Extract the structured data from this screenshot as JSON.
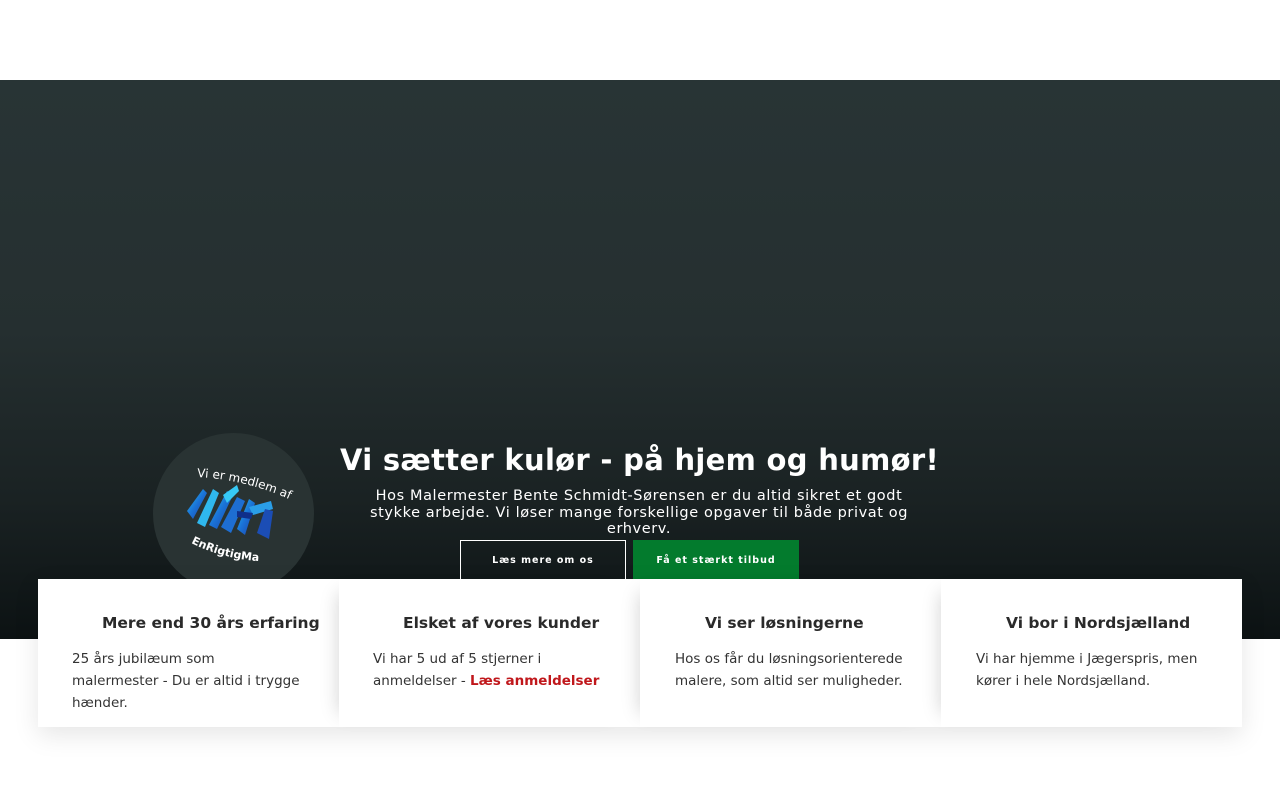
{
  "hero": {
    "title": "Vi sætter kulør - på hjem og humør!",
    "subtitle": "Hos Malermester Bente Schmidt-Sørensen er du altid sikret et godt stykke arbejde. Vi løser mange forskellige opgaver til både privat og erhverv.",
    "button_about": "Læs mere om os",
    "button_offer": "Få et stærkt tilbud",
    "accent_color": "#037b2d"
  },
  "badge": {
    "top_text": "Vi er medlem af",
    "bottom_text": "EnRigtigMaler.dk"
  },
  "features": [
    {
      "title": "Mere end 30 års erfaring",
      "text": "25 års jubilæum som malermester - Du er altid i trygge hænder."
    },
    {
      "title": "Elsket af vores kunder",
      "text": "Vi har 5 ud af 5 stjerner i anmeldelser - ",
      "link": "Læs anmeldelser"
    },
    {
      "title": "Vi ser løsningerne",
      "text": "Hos os får du løsningsorienterede malere, som altid ser muligheder."
    },
    {
      "title": "Vi bor i Nordsjælland",
      "text": "Vi har hjemme i Jægerspris, men kører i hele Nordsjælland."
    }
  ]
}
